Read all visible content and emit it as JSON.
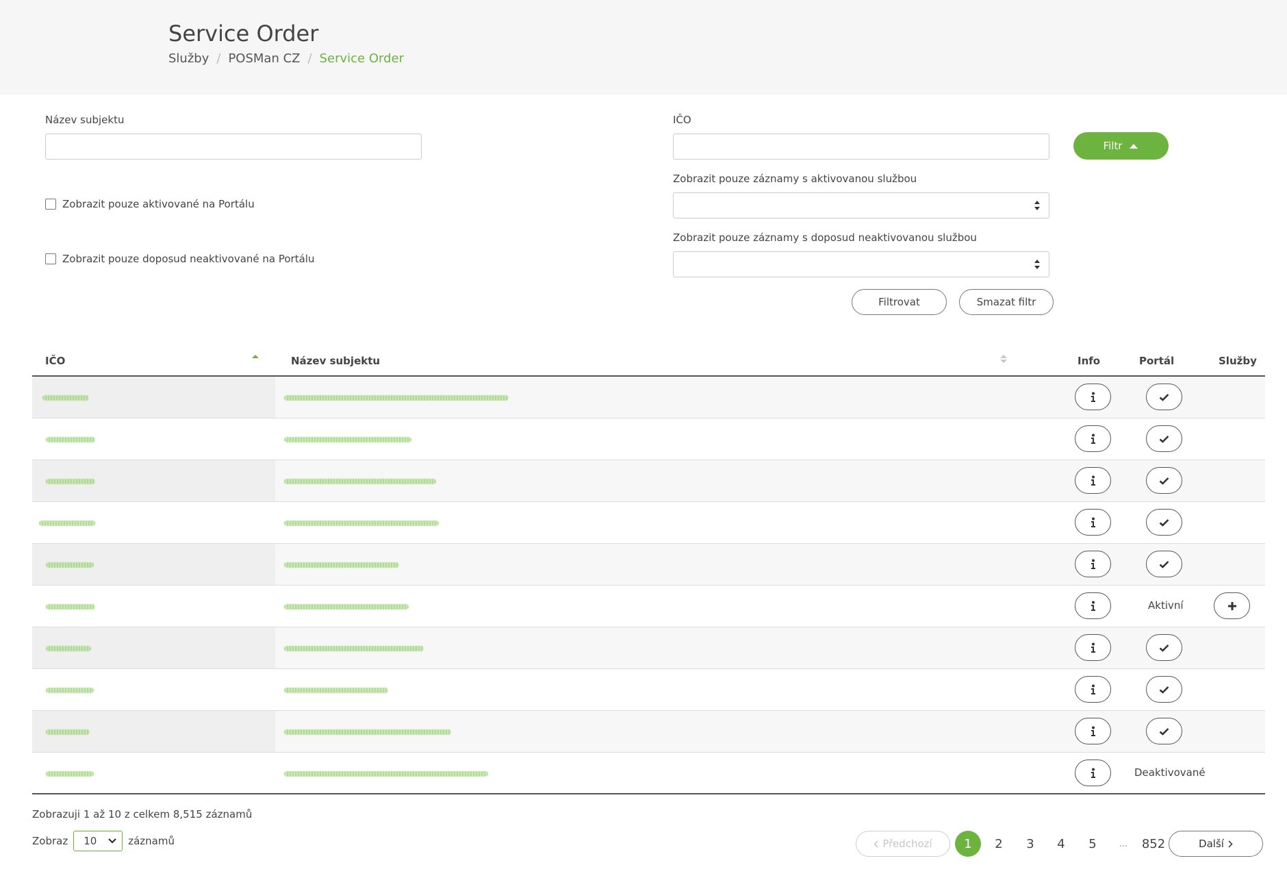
{
  "header": {
    "title": "Service Order",
    "breadcrumb": [
      "Služby",
      "POSMan CZ",
      "Service Order"
    ]
  },
  "filters": {
    "name_label": "Název subjektu",
    "ico_label": "IČO",
    "filter_button": "Filtr",
    "active_service_label": "Zobrazit pouze záznamy s aktivovanou službou",
    "inactive_service_label": "Zobrazit pouze záznamy s doposud neaktivovanou službou",
    "portal_active_checkbox": "Zobrazit pouze aktivované na Portálu",
    "portal_inactive_checkbox": "Zobrazit pouze doposud neaktivované na Portálu",
    "apply_button": "Filtrovat",
    "clear_button": "Smazat filtr"
  },
  "table": {
    "columns": [
      "IČO",
      "Název subjektu",
      "Info",
      "Portál",
      "Služby"
    ],
    "portal_active_text": "Aktivní",
    "portal_deactivated_text": "Deaktivované",
    "rows": [
      {
        "portal": "check"
      },
      {
        "portal": "check"
      },
      {
        "portal": "check"
      },
      {
        "portal": "check"
      },
      {
        "portal": "check"
      },
      {
        "portal": "Aktivní",
        "sluzby": "plus"
      },
      {
        "portal": "check"
      },
      {
        "portal": "check"
      },
      {
        "portal": "check"
      },
      {
        "portal": "Deaktivované"
      }
    ]
  },
  "footer": {
    "info": "Zobrazuji 1 až 10 z celkem 8,515 záznamů",
    "show_label": "Zobraz",
    "page_size": "10",
    "records_label": "záznamů"
  },
  "pagination": {
    "prev": "Předchozí",
    "next": "Další",
    "pages": [
      "1",
      "2",
      "3",
      "4",
      "5"
    ],
    "ellipsis": "...",
    "last": "852",
    "current": "1"
  },
  "colors": {
    "accent": "#6cb33f",
    "header_bg": "#f6f6f6"
  },
  "icons": {
    "info": "info-icon",
    "check": "checkmark-icon",
    "plus": "plus-icon",
    "sort": "sort-icon"
  }
}
